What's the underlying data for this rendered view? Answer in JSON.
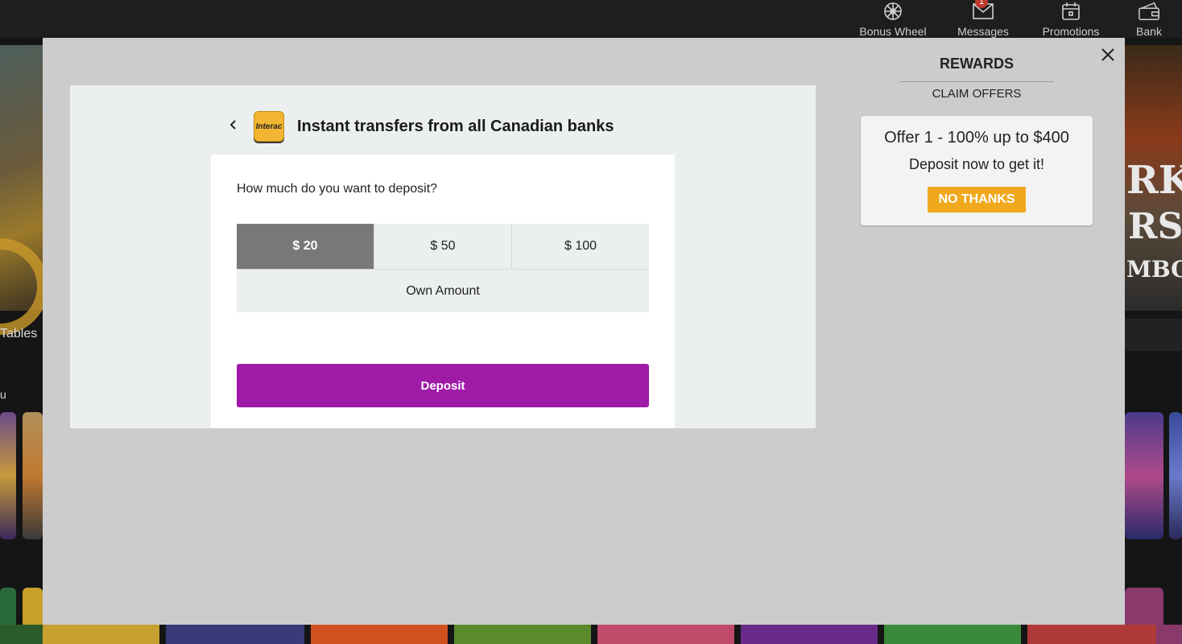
{
  "topnav": {
    "items": [
      {
        "label": "Bonus Wheel",
        "icon": "wheel-icon"
      },
      {
        "label": "Messages",
        "icon": "envelope-icon",
        "badge": "1"
      },
      {
        "label": "Promotions",
        "icon": "calendar-icon"
      },
      {
        "label": "Bank",
        "icon": "wallet-icon"
      }
    ]
  },
  "background": {
    "tables_label": "Tables",
    "section_label": "u",
    "right_banner_lines": [
      "RK",
      "RS",
      "MBO"
    ]
  },
  "payment": {
    "logo_text": "Interac",
    "title": "Instant transfers from all Canadian banks",
    "question": "How much do you want to deposit?",
    "amounts": [
      "$ 20",
      "$ 50",
      "$ 100"
    ],
    "selected_amount": "$ 20",
    "own_amount_label": "Own Amount",
    "deposit_label": "Deposit"
  },
  "rewards": {
    "title": "REWARDS",
    "claim_offers": "CLAIM OFFERS",
    "offer_title": "Offer 1 - 100% up to $400",
    "offer_subtitle": "Deposit now to get it!",
    "no_thanks": "NO THANKS"
  },
  "colors": {
    "deposit_button": "#a01aa8",
    "no_thanks_button": "#f0a81c",
    "selected_amount_bg": "#787878",
    "modal_bg": "#cccccc"
  }
}
